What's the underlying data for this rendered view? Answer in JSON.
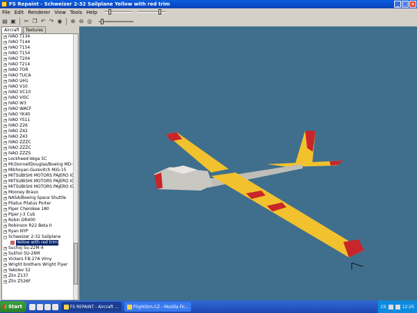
{
  "window": {
    "title": "FS Repaint - Schweizer 2-32 Sailplane Yellow with red trim",
    "minimize": "_",
    "maximize": "□",
    "close": "×"
  },
  "menu": [
    "File",
    "Edit",
    "Renderer",
    "View",
    "Tools",
    "Help"
  ],
  "sliders": [
    0.18,
    0.82
  ],
  "zoom": 0.06,
  "tabs": [
    "Aircraft",
    "Textures"
  ],
  "tree": {
    "items": [
      "IVAO T134",
      "IVAO T144",
      "IVAO T154",
      "IVAO T154",
      "IVAO T204",
      "IVAO T214",
      "IVAO TOR",
      "IVAO TUCA",
      "IVAO UH1",
      "IVAO V10",
      "IVAO VC10",
      "IVAO VISC",
      "IVAO W3",
      "IVAO WACF",
      "IVAO YK40",
      "IVAO YS11",
      "IVAO Z26",
      "IVAO Z42",
      "IVAO Z43",
      "IVAO ZZZC",
      "IVAO ZZZC",
      "IVAO ZZZS",
      "Lockheed-Vega 5C",
      "McDonnellDouglas/Boeing MD-83",
      "Mikhoyan-Gurevitch MiG-15",
      "MITSUBISHI MOTORS PAJERO IO",
      "MITSUBISHI MOTORS PAJERO IO",
      "MITSUBISHI MOTORS PAJERO IO",
      "Mooney Bravo",
      "NASA/Boeing Space Shuttle",
      "Pilatus Pilatus Porter",
      "Piper Cherokee 180",
      "Piper J-3 Cub",
      "Robin DR400",
      "Robinson R22 Beta II",
      "Ryan NYP",
      "Schweizer 2-32 Sailplane"
    ],
    "selected_child": "Yellow with red trim",
    "items_after": [
      "Suchoj Su-22M-4",
      "Sukhoi SU-26M",
      "Vickers F.B.27A Vimy",
      "Wright brothers Wright Flyer",
      "Yakolev 52",
      "Zlin Z137",
      "Zlin Z526F"
    ],
    "expand_plus": "+",
    "expand_minus": "−"
  },
  "taskbar": {
    "start": "Start",
    "tasks": [
      "FS REPAINT - Aircraft ...",
      "FlightSim.CZ - Mozilla Fir..."
    ],
    "tray_lang": "CS",
    "clock": "12:25"
  },
  "colors": {
    "viewport_bg": "#3f6f8c",
    "wing_yellow": "#f2c12e",
    "trim_red": "#c8262a",
    "fuselage_gray": "#c9c7c2"
  }
}
